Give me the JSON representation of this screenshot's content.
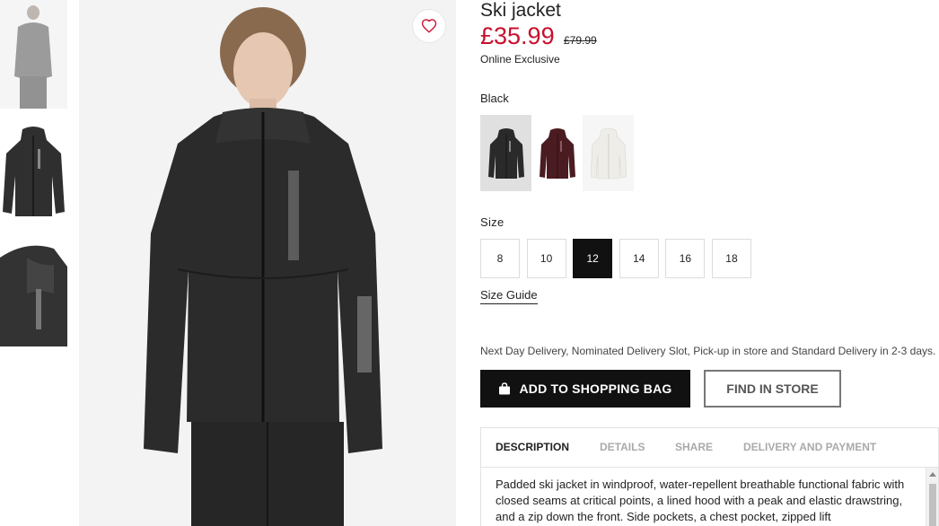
{
  "product": {
    "title": "Ski jacket",
    "price": "£35.99",
    "old_price": "£79.99",
    "availability": "Online Exclusive",
    "color_label": "Black",
    "colors": [
      {
        "name": "Black",
        "hex": "#2a2a2a",
        "selected": true
      },
      {
        "name": "Burgundy",
        "hex": "#4a1c22",
        "selected": false
      },
      {
        "name": "White",
        "hex": "#efede8",
        "selected": false
      }
    ],
    "size_label": "Size",
    "sizes": [
      "8",
      "10",
      "12",
      "14",
      "16",
      "18"
    ],
    "selected_size": "12",
    "size_guide": "Size Guide",
    "delivery_text": "Next Day Delivery, Nominated Delivery Slot, Pick-up in store and Standard Delivery in 2-3 days.",
    "add_to_bag": "ADD TO SHOPPING BAG",
    "find_in_store": "FIND IN STORE"
  },
  "tabs": [
    "DESCRIPTION",
    "DETAILS",
    "SHARE",
    "DELIVERY AND PAYMENT"
  ],
  "active_tab": "DESCRIPTION",
  "description": "Padded ski jacket in windproof, water-repellent breathable functional fabric with closed seams at critical points, a lined hood with a peak and elastic drawstring, and a zip down the front. Side pockets, a chest pocket, zipped lift",
  "icons": {
    "favorite": "heart-icon",
    "bag": "shopping-bag-icon"
  },
  "colors_ui": {
    "price": "#c8102e",
    "button_bg": "#111111"
  }
}
